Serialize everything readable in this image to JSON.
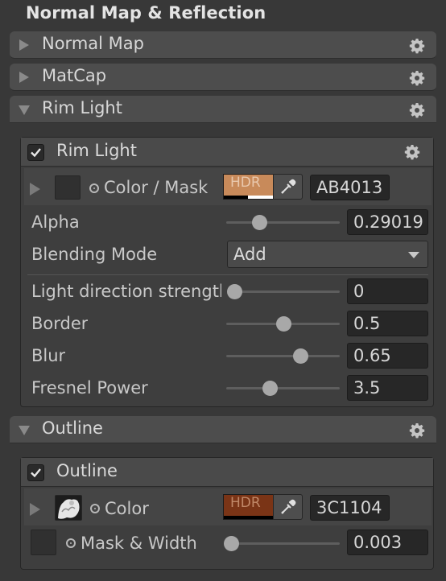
{
  "section_title": "Normal Map & Reflection",
  "foldouts": {
    "normal_map": "Normal Map",
    "matcap": "MatCap",
    "rim_light": "Rim Light",
    "outline": "Outline"
  },
  "rim_light": {
    "header": "Rim Light",
    "enabled": true,
    "color_mask": {
      "label": "Color / Mask",
      "hdr_label": "HDR",
      "color": "#AB4013",
      "swatch_color": "#c88a5a",
      "hex": "AB4013"
    },
    "alpha": {
      "label": "Alpha",
      "value": "0.29019",
      "fraction": 0.29
    },
    "blending_mode": {
      "label": "Blending Mode",
      "selected": "Add"
    },
    "light_direction_strength": {
      "label": "Light direction strength",
      "value": "0",
      "fraction": 0
    },
    "border": {
      "label": "Border",
      "value": "0.5",
      "fraction": 0.5
    },
    "blur": {
      "label": "Blur",
      "value": "0.65",
      "fraction": 0.65
    },
    "fresnel_power": {
      "label": "Fresnel Power",
      "value": "3.5",
      "fraction": 0.38
    }
  },
  "outline": {
    "header": "Outline",
    "enabled": true,
    "color": {
      "label": "Color",
      "hdr_label": "HDR",
      "color": "#3C1104",
      "swatch_color": "#7a3416",
      "hex": "3C1104"
    },
    "mask_width": {
      "label": "Mask & Width",
      "value": "0.003",
      "fraction": 0.04
    }
  },
  "icons": [
    "gear-icon",
    "foldout-arrow-icon",
    "checkmark-icon",
    "eyedropper-icon",
    "target-dot-icon",
    "dropdown-arrow-icon",
    "texture-thumbnail"
  ]
}
